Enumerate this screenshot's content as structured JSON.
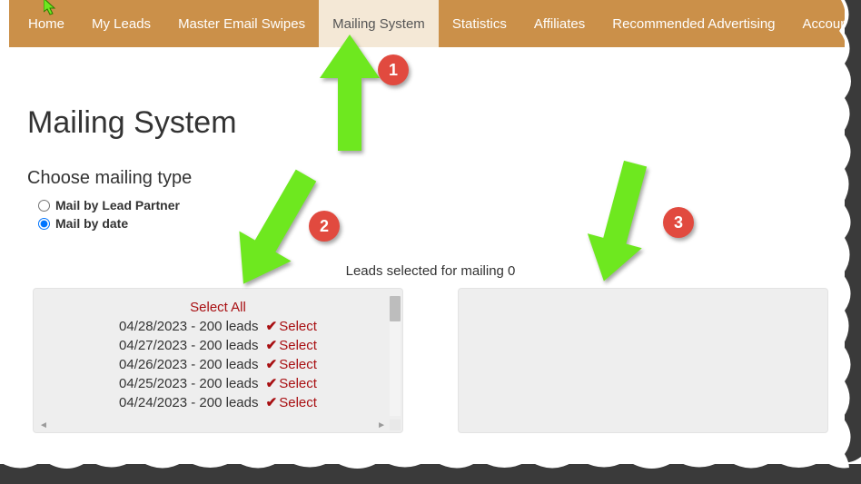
{
  "nav": {
    "items": [
      {
        "label": "Home",
        "active": false
      },
      {
        "label": "My Leads",
        "active": false
      },
      {
        "label": "Master Email Swipes",
        "active": false
      },
      {
        "label": "Mailing System",
        "active": true
      },
      {
        "label": "Statistics",
        "active": false
      },
      {
        "label": "Affiliates",
        "active": false
      },
      {
        "label": "Recommended Advertising",
        "active": false
      },
      {
        "label": "Account",
        "active": false,
        "dropdown": true
      }
    ]
  },
  "page": {
    "title": "Mailing System",
    "choose_label": "Choose mailing type",
    "radio_partner": "Mail by Lead Partner",
    "radio_date": "Mail by date",
    "leads_counter_prefix": "Leads selected for mailing ",
    "leads_counter_value": "0"
  },
  "panel": {
    "select_all": "Select All",
    "select_label": "Select",
    "rows": [
      {
        "text": "04/28/2023 - 200 leads"
      },
      {
        "text": "04/27/2023 - 200 leads"
      },
      {
        "text": "04/26/2023 - 200 leads"
      },
      {
        "text": "04/25/2023 - 200 leads"
      },
      {
        "text": "04/24/2023 - 200 leads"
      }
    ]
  },
  "annotations": {
    "b1": "1",
    "b2": "2",
    "b3": "3"
  }
}
